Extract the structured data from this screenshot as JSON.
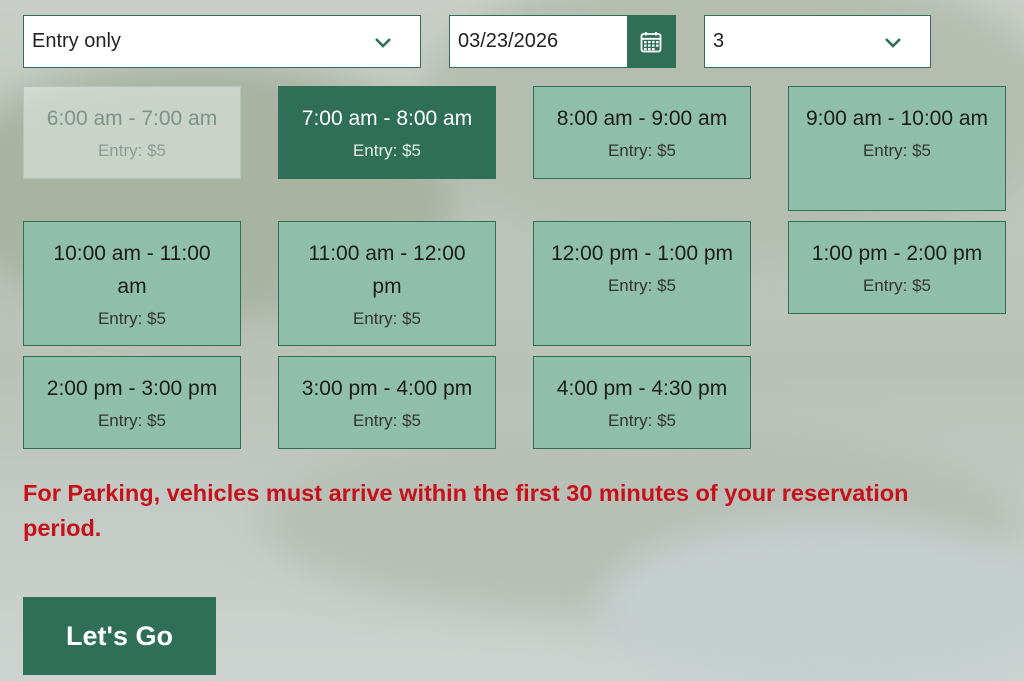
{
  "filters": {
    "entry_type": "Entry only",
    "date": "03/23/2026",
    "count": "3"
  },
  "slots": [
    {
      "time": "6:00 am - 7:00 am",
      "price": "Entry: $5",
      "state": "disabled"
    },
    {
      "time": "7:00 am - 8:00 am",
      "price": "Entry: $5",
      "state": "selected"
    },
    {
      "time": "8:00 am - 9:00 am",
      "price": "Entry: $5",
      "state": "available"
    },
    {
      "time": "9:00 am - 10:00 am",
      "price": "Entry: $5",
      "state": "available"
    },
    {
      "time": "10:00 am - 11:00 am",
      "price": "Entry: $5",
      "state": "available"
    },
    {
      "time": "11:00 am - 12:00 pm",
      "price": "Entry: $5",
      "state": "available"
    },
    {
      "time": "12:00 pm - 1:00 pm",
      "price": "Entry: $5",
      "state": "available"
    },
    {
      "time": "1:00 pm - 2:00 pm",
      "price": "Entry: $5",
      "state": "available"
    },
    {
      "time": "2:00 pm - 3:00 pm",
      "price": "Entry: $5",
      "state": "available"
    },
    {
      "time": "3:00 pm - 4:00 pm",
      "price": "Entry: $5",
      "state": "available"
    },
    {
      "time": "4:00 pm - 4:30 pm",
      "price": "Entry: $5",
      "state": "available"
    }
  ],
  "notice": "For Parking, vehicles must arrive within the first 30 minutes of your reservation period.",
  "submit_label": "Let's Go",
  "icons": {
    "dropdown": "chevron-down-icon",
    "date_picker": "calendar-icon"
  },
  "colors": {
    "primary_green": "#2f6e57",
    "slot_green": "#8fbfaa",
    "notice_red": "#c8101a"
  }
}
